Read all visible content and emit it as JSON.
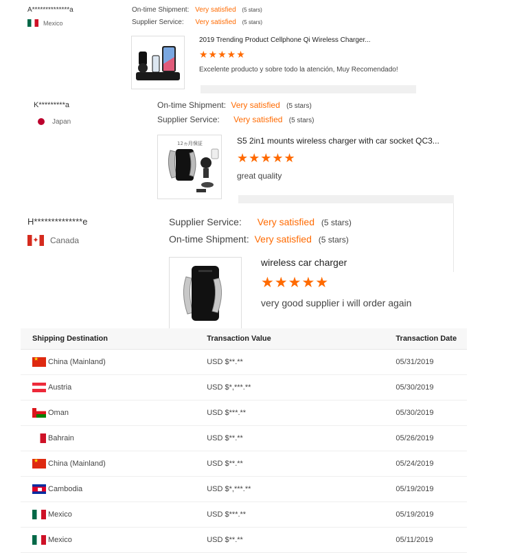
{
  "reviews": [
    {
      "name": "A**************a",
      "country": "Mexico",
      "flag": "mx",
      "rows": [
        {
          "label": "On-time Shipment:",
          "value": "Very satisfied",
          "note": "(5 stars)"
        },
        {
          "label": "Supplier Service:",
          "value": "Very satisfied",
          "note": "(5 stars)"
        }
      ],
      "product_title": "2019 Trending Product Cellphone Qi Wireless Charger...",
      "stars": "★★★★★",
      "rating": 5,
      "comment": "Excelente producto y sobre todo la atención, Muy Recomendado!"
    },
    {
      "name": "K*********a",
      "country": "Japan",
      "flag": "jp",
      "rows": [
        {
          "label": "On-time Shipment:",
          "value": "Very satisfied",
          "note": "(5 stars)"
        },
        {
          "label": "Supplier Service:",
          "value": "Very satisfied",
          "note": "(5 stars)"
        }
      ],
      "product_title": "S5 2in1 mounts wireless charger with car socket QC3...",
      "image_text": "12ヵ月保証",
      "stars": "★★★★★",
      "rating": 5,
      "comment": "great quality"
    },
    {
      "name": "H**************e",
      "country": "Canada",
      "flag": "ca",
      "rows": [
        {
          "label": "Supplier Service:",
          "value": "Very satisfied",
          "note": "(5 stars)"
        },
        {
          "label": "On-time Shipment:",
          "value": "Very satisfied",
          "note": "(5 stars)"
        }
      ],
      "product_title": "wireless car charger",
      "stars": "★★★★★",
      "rating": 5,
      "comment": "very good supplier i will order again"
    }
  ],
  "transactions": {
    "headers": [
      "Shipping Destination",
      "Transaction Value",
      "Transaction Date"
    ],
    "rows": [
      {
        "destination": "China (Mainland)",
        "flag": "cn",
        "value": "USD $**.**",
        "date": "05/31/2019"
      },
      {
        "destination": "Austria",
        "flag": "at",
        "value": "USD $*,***.**",
        "date": "05/30/2019"
      },
      {
        "destination": "Oman",
        "flag": "om",
        "value": "USD $***.**",
        "date": "05/30/2019"
      },
      {
        "destination": "Bahrain",
        "flag": "bh",
        "value": "USD $**.**",
        "date": "05/26/2019"
      },
      {
        "destination": "China (Mainland)",
        "flag": "cn",
        "value": "USD $**.**",
        "date": "05/24/2019"
      },
      {
        "destination": "Cambodia",
        "flag": "kh",
        "value": "USD $*,***.**",
        "date": "05/19/2019"
      },
      {
        "destination": "Mexico",
        "flag": "mx",
        "value": "USD $***.**",
        "date": "05/19/2019"
      },
      {
        "destination": "Mexico",
        "flag": "mx",
        "value": "USD $**.**",
        "date": "05/11/2019"
      }
    ]
  },
  "colors": {
    "accent": "#ff6a00",
    "text": "#333333",
    "header_bg": "#f7f7f7"
  }
}
